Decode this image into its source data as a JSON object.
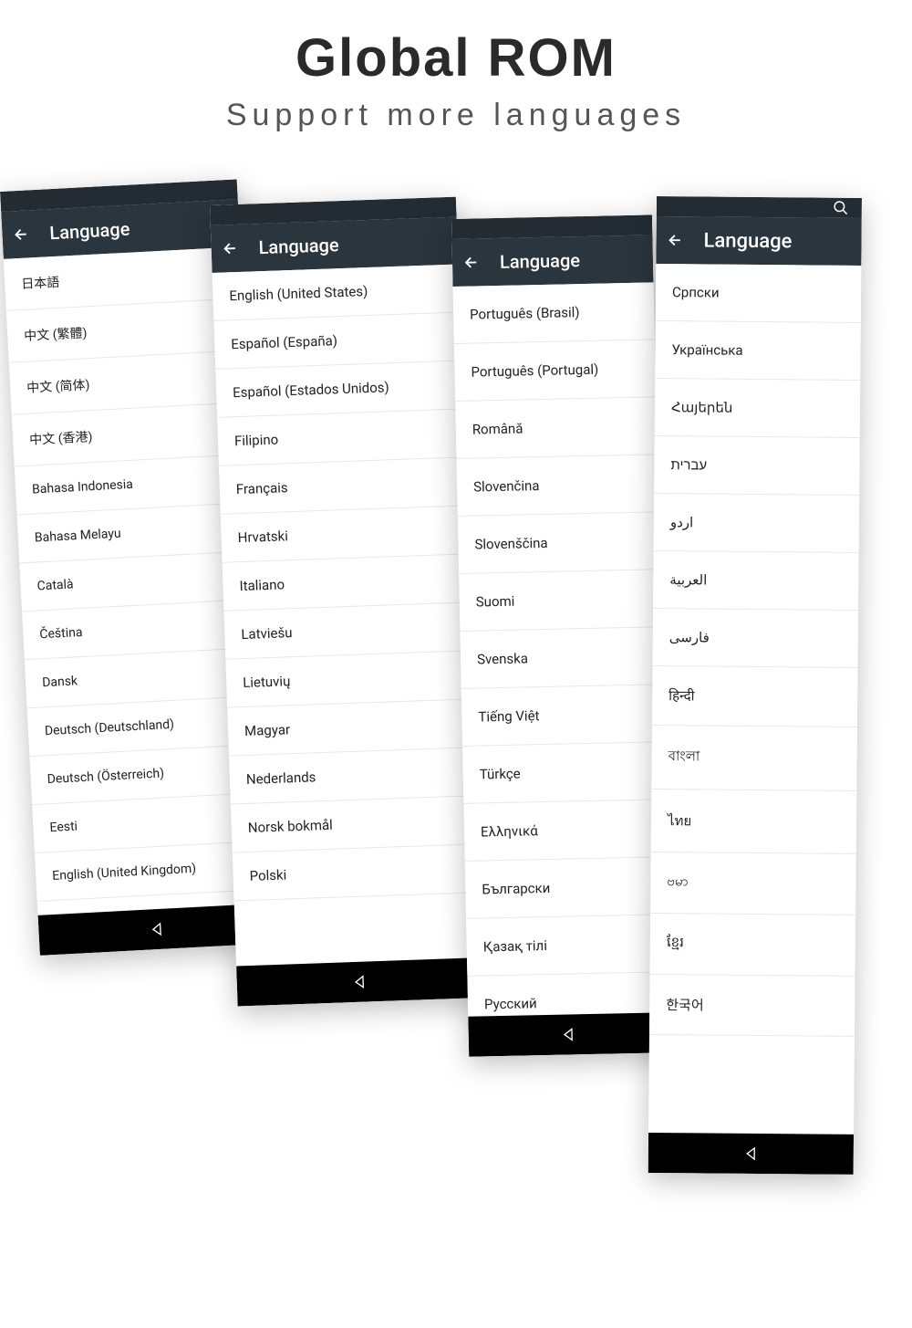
{
  "title": "Global ROM",
  "subtitle": "Support more languages",
  "header_label": "Language",
  "phones": [
    {
      "id": "p1",
      "show_search": false,
      "items": [
        "日本語",
        "中文 (繁體)",
        "中文 (简体)",
        "中文 (香港)",
        "Bahasa Indonesia",
        "Bahasa Melayu",
        "Català",
        "Čeština",
        "Dansk",
        "Deutsch (Deutschland)",
        "Deutsch (Österreich)",
        "Eesti",
        "English (United Kingdom)"
      ]
    },
    {
      "id": "p2",
      "show_search": false,
      "items": [
        "English (United States)",
        "Español (España)",
        "Español (Estados Unidos)",
        "Filipino",
        "Français",
        "Hrvatski",
        "Italiano",
        "Latviešu",
        "Lietuvių",
        "Magyar",
        "Nederlands",
        "Norsk bokmål",
        "Polski"
      ]
    },
    {
      "id": "p3",
      "show_search": false,
      "items": [
        "Português (Brasil)",
        "Português (Portugal)",
        "Română",
        "Slovenčina",
        "Slovenščina",
        "Suomi",
        "Svenska",
        "Tiếng Việt",
        "Türkçe",
        "Ελληνικά",
        "Български",
        "Қазақ тілі",
        "Русский"
      ]
    },
    {
      "id": "p4",
      "show_search": true,
      "items": [
        "Српски",
        "Українська",
        "Հայերեն",
        "עברית",
        "اردو",
        "العربية",
        "فارسی",
        "हिन्दी",
        "বাংলা",
        "ไทย",
        "ဗမာ",
        "ខ្មែរ",
        "한국어"
      ]
    }
  ]
}
